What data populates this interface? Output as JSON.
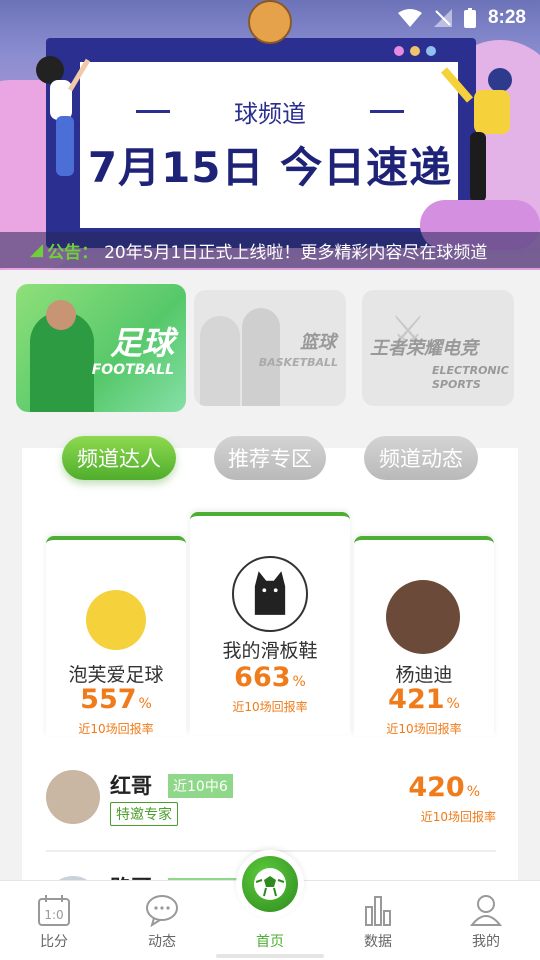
{
  "status_bar": {
    "time": "8:28"
  },
  "banner": {
    "subtitle": "球频道",
    "title": "7月15日  今日速递",
    "notice_label": "公告：",
    "notice_text": "20年5月1日正式上线啦！更多精彩内容尽在球频道"
  },
  "categories": [
    {
      "name": "足球",
      "en": "FOOTBALL",
      "selected": true
    },
    {
      "name": "篮球",
      "en": "BASKETBALL",
      "selected": false
    },
    {
      "name": "王者荣耀电竞",
      "en": "ELECTRONIC SPORTS",
      "selected": false
    }
  ],
  "tabs": [
    "频道达人",
    "推荐专区",
    "频道动态"
  ],
  "top_experts": [
    {
      "name": "泡芙爱足球",
      "rate": "557",
      "pct": "%",
      "rate_label": "近10场回报率"
    },
    {
      "name": "我的滑板鞋",
      "rate": "663",
      "pct": "%",
      "rate_label": "近10场回报率"
    },
    {
      "name": "杨迪迪",
      "rate": "421",
      "pct": "%",
      "rate_label": "近10场回报率"
    }
  ],
  "list": [
    {
      "name": "红哥",
      "record": "近10中6",
      "badge": "特邀专家",
      "rate": "420",
      "pct": "%",
      "rate_label": "近10场回报率"
    },
    {
      "name": "路哥"
    }
  ],
  "bottom_nav": [
    {
      "label": "比分",
      "icon": "scoreboard-icon"
    },
    {
      "label": "动态",
      "icon": "chat-bubble-icon"
    },
    {
      "label": "首页",
      "icon": "soccer-ball-icon"
    },
    {
      "label": "数据",
      "icon": "bar-chart-icon"
    },
    {
      "label": "我的",
      "icon": "user-icon"
    }
  ],
  "colors": {
    "accent_green": "#4caf33",
    "rate_orange": "#f07b1a",
    "banner_navy": "#1e2378"
  }
}
